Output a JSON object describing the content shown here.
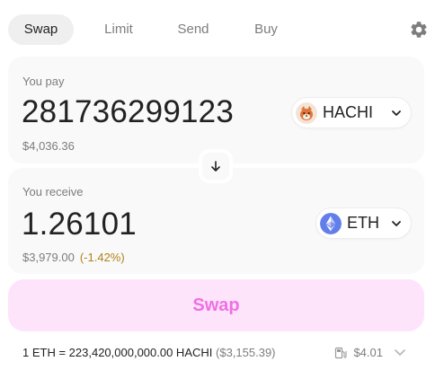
{
  "tabs": [
    {
      "label": "Swap",
      "active": true
    },
    {
      "label": "Limit",
      "active": false
    },
    {
      "label": "Send",
      "active": false
    },
    {
      "label": "Buy",
      "active": false
    }
  ],
  "settings_icon": "gear-icon",
  "pay": {
    "label": "You pay",
    "amount": "281736299123",
    "usd_value": "$4,036.36",
    "token": {
      "symbol": "HACHI",
      "icon": "hachi-token-icon"
    }
  },
  "receive": {
    "label": "You receive",
    "amount": "1.26101",
    "usd_value": "$3,979.00",
    "price_impact": "(-1.42%)",
    "token": {
      "symbol": "ETH",
      "icon": "eth-token-icon"
    }
  },
  "switch_icon": "arrow-down-icon",
  "swap_button": {
    "label": "Swap"
  },
  "rate": {
    "text": "1 ETH = 223,420,000,000.00 HACHI",
    "usd": "($3,155.39)"
  },
  "gas": {
    "icon": "gas-pump-icon",
    "value": "$4.01"
  },
  "colors": {
    "accent": "#f06fe5",
    "accent_bg": "#fde4fb",
    "price_impact": "#b08317",
    "panel_bg": "#f9f9f9",
    "eth": "#627eea",
    "hachi": "#e0743a"
  }
}
